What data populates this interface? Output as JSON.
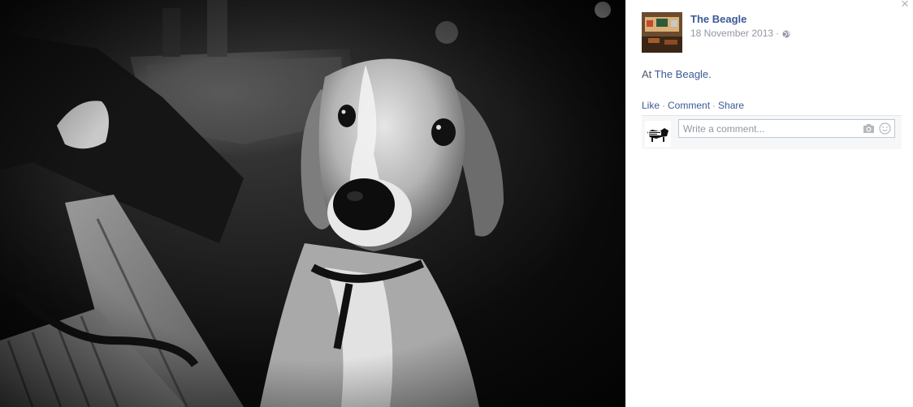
{
  "photo": {
    "icon": "beagle-photo"
  },
  "viewer": {
    "close_icon": "close-icon",
    "close_glyph": "×"
  },
  "post": {
    "page_name": "The Beagle",
    "date": "18 November 2013",
    "meta_separator": "·",
    "privacy_icon": "globe-icon",
    "caption_prefix": "At ",
    "caption_place": "The Beagle",
    "caption_suffix": "."
  },
  "actions": {
    "like": "Like",
    "comment": "Comment",
    "share": "Share",
    "separator": "·"
  },
  "comment_box": {
    "placeholder": "Write a comment...",
    "value": "",
    "camera_icon": "camera-icon",
    "emoji_icon": "smiley-icon"
  },
  "colors": {
    "link": "#3b5998",
    "meta": "#9197a3",
    "photo_bg": "#000000"
  }
}
